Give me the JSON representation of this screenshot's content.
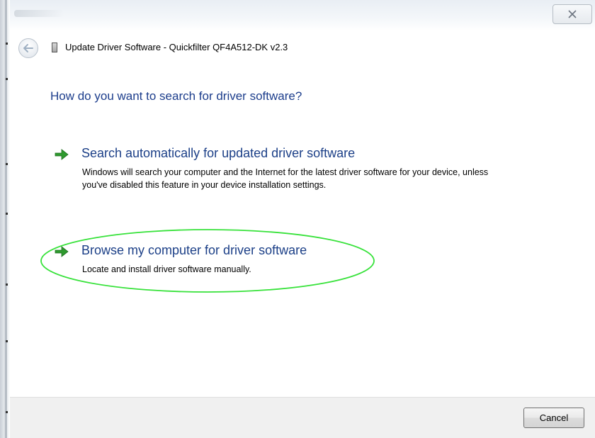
{
  "window": {
    "title": "Update Driver Software - Quickfilter QF4A512-DK v2.3"
  },
  "heading": "How do you want to search for driver software?",
  "options": [
    {
      "title": "Search automatically for updated driver software",
      "description": "Windows will search your computer and the Internet for the latest driver software for your device, unless you've disabled this feature in your device installation settings."
    },
    {
      "title": "Browse my computer for driver software",
      "description": "Locate and install driver software manually."
    }
  ],
  "footer": {
    "cancel_label": "Cancel"
  },
  "icons": {
    "back": "back-arrow-icon",
    "close": "close-icon",
    "device": "device-icon",
    "option_arrow": "green-arrow-icon"
  },
  "colors": {
    "heading": "#1c3d8c",
    "option_title": "#1b3f87",
    "arrow": "#2e9a2e",
    "highlight": "#37e23a"
  }
}
